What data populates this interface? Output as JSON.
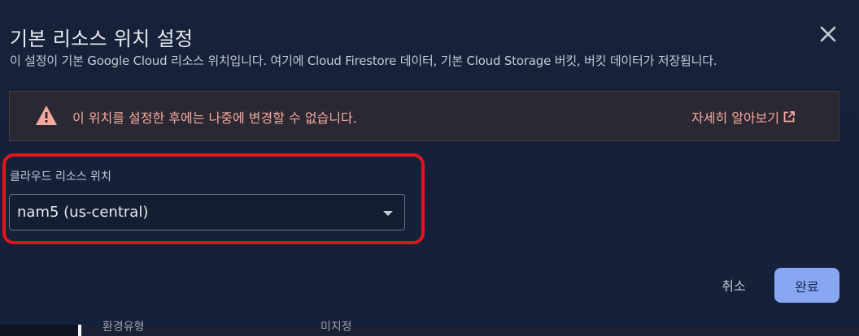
{
  "dialog": {
    "title": "기본 리소스 위치 설정",
    "subtitle": "이 설정이 기본 Google Cloud 리소스 위치입니다. 여기에 Cloud Firestore 데이터, 기본 Cloud Storage 버킷, 버킷 데이터가 저장됩니다.",
    "close_icon": "close-icon"
  },
  "warning": {
    "icon": "warning-triangle-icon",
    "text": "이 위치를 설정한 후에는 나중에 변경할 수 없습니다.",
    "learn_more": "자세히 알아보기",
    "learn_more_icon": "open-in-new-icon",
    "color": "#f4a99e"
  },
  "location_field": {
    "label": "클라우드 리소스 위치",
    "value": "nam5 (us-central)",
    "arrow_icon": "dropdown-arrow-icon",
    "highlight_color": "#e0161c"
  },
  "actions": {
    "cancel_label": "취소",
    "done_label": "완료",
    "done_color": "#87a7f2"
  },
  "background": {
    "left_text": "환경유형",
    "right_text": "미지정"
  }
}
